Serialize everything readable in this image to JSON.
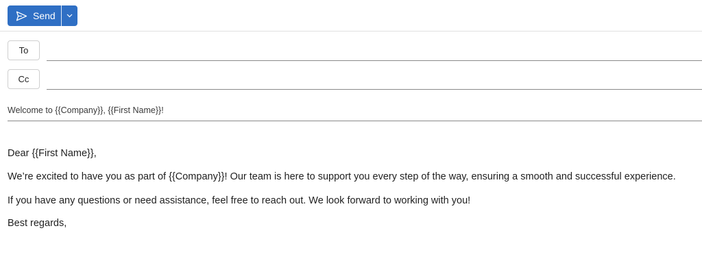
{
  "toolbar": {
    "send_label": "Send",
    "send_icon": "send-icon",
    "dropdown_icon": "chevron-down-icon",
    "accent": "#2f6fc4"
  },
  "fields": {
    "to_label": "To",
    "to_value": "",
    "cc_label": "Cc",
    "cc_value": ""
  },
  "subject": "Welcome to {{Company}}, {{First Name}}!",
  "body": {
    "greeting": "Dear {{First Name}},",
    "paragraph1": "We’re excited to have you as part of {{Company}}! Our team is here to support you every step of the way, ensuring a smooth and successful experience.",
    "paragraph2": "If you have any questions or need assistance, feel free to reach out. We look forward to working with you!",
    "signoff": "Best regards,"
  }
}
